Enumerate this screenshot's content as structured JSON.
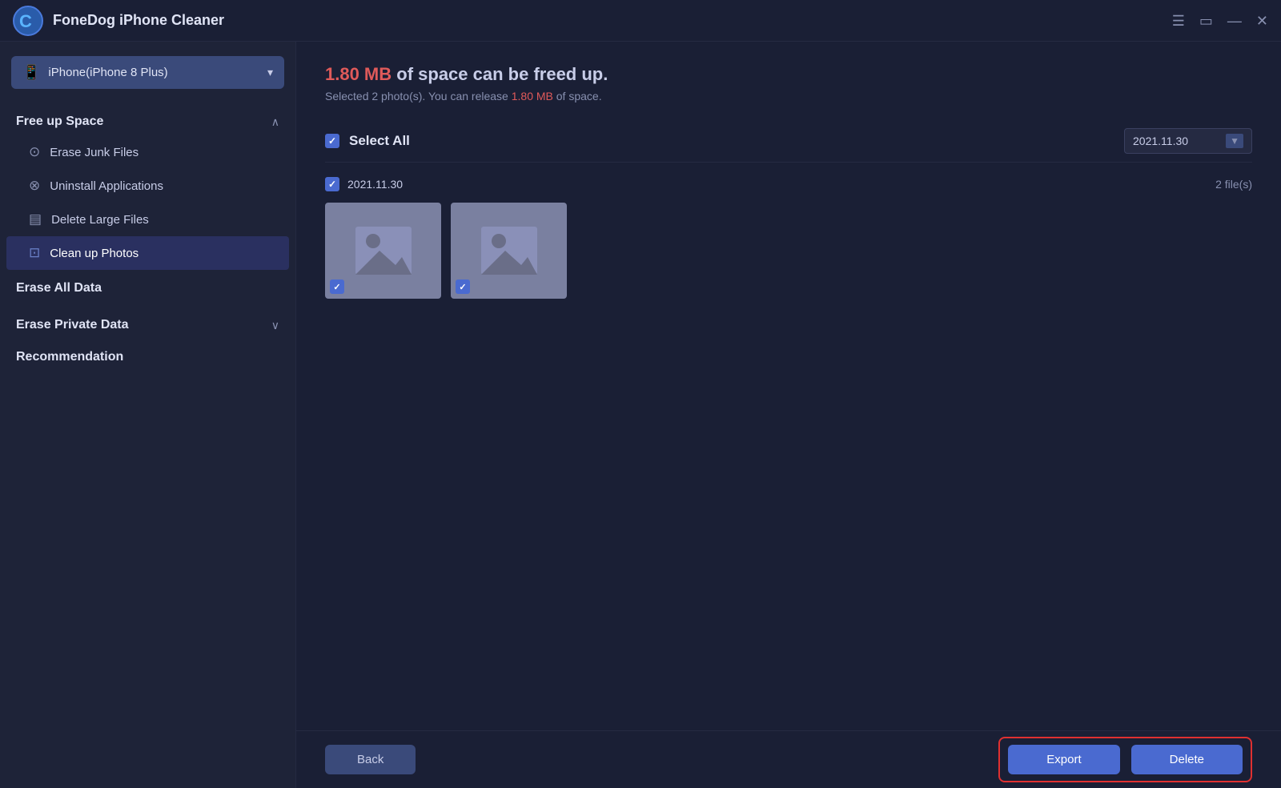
{
  "app": {
    "title": "FoneDog iPhone Cleaner",
    "logo_letter": "C"
  },
  "titlebar": {
    "controls": {
      "menu_icon": "☰",
      "chat_icon": "▭",
      "minimize_icon": "—",
      "close_icon": "✕"
    }
  },
  "device": {
    "name": "iPhone(iPhone 8 Plus)",
    "chevron": "▾"
  },
  "sidebar": {
    "sections": [
      {
        "id": "free-up-space",
        "title": "Free up Space",
        "expanded": true,
        "chevron": "∧",
        "items": [
          {
            "id": "erase-junk",
            "label": "Erase Junk Files",
            "icon": "⊙",
            "active": false
          },
          {
            "id": "uninstall-apps",
            "label": "Uninstall Applications",
            "icon": "⊗",
            "active": false
          },
          {
            "id": "delete-large",
            "label": "Delete Large Files",
            "icon": "▤",
            "active": false
          },
          {
            "id": "clean-photos",
            "label": "Clean up Photos",
            "icon": "⊡",
            "active": true
          }
        ]
      },
      {
        "id": "erase-all-data",
        "title": "Erase All Data",
        "expanded": false,
        "simple": true
      },
      {
        "id": "erase-private-data",
        "title": "Erase Private Data",
        "expanded": false,
        "chevron": "∨"
      },
      {
        "id": "recommendation",
        "title": "Recommendation",
        "expanded": false,
        "simple": true
      }
    ]
  },
  "main": {
    "space_amount": "1.80 MB",
    "space_text": " of space can be freed up.",
    "selected_count": "2",
    "release_amount": "1.80 MB",
    "subtitle_prefix": "Selected ",
    "subtitle_mid": " photo(s). You can release ",
    "subtitle_suffix": " of space.",
    "select_all_label": "Select All",
    "date_filter": "2021.11.30",
    "photo_groups": [
      {
        "id": "group-2021-11-30",
        "date": "2021.11.30",
        "count": "2 file(s)",
        "photos": [
          {
            "id": "photo-1",
            "checked": true
          },
          {
            "id": "photo-2",
            "checked": true
          }
        ]
      }
    ]
  },
  "buttons": {
    "back": "Back",
    "export": "Export",
    "delete": "Delete"
  }
}
